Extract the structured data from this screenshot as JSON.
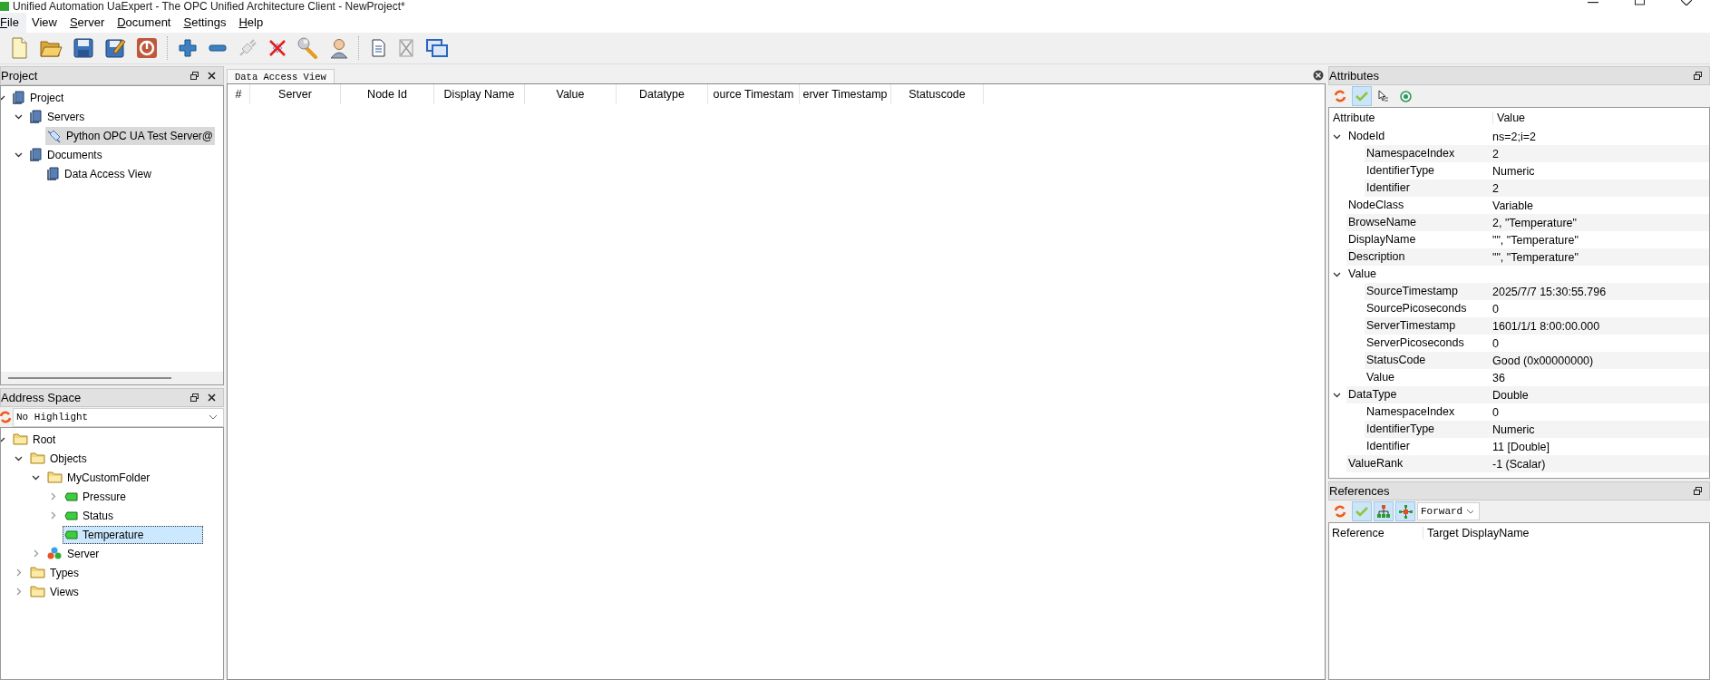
{
  "window": {
    "title": "Unified Automation UaExpert - The OPC Unified Architecture Client - NewProject*"
  },
  "menu": [
    {
      "label": "File",
      "underlined": true,
      "selected": true
    },
    {
      "label": "View",
      "underlined": false,
      "selected": false
    },
    {
      "label": "Server",
      "underlined": true,
      "selected": false
    },
    {
      "label": "Document",
      "underlined": true,
      "selected": false
    },
    {
      "label": "Settings",
      "underlined": true,
      "selected": false
    },
    {
      "label": "Help",
      "underlined": true,
      "selected": false
    }
  ],
  "project": {
    "title": "Project",
    "tree": [
      {
        "label": "Project",
        "kind": "book",
        "expanded": true,
        "selected": false,
        "children": [
          {
            "label": "Servers",
            "kind": "book",
            "expanded": true,
            "selected": false,
            "children": [
              {
                "label": "Python OPC UA Test Server@",
                "kind": "plug",
                "selected": true
              }
            ]
          },
          {
            "label": "Documents",
            "kind": "book",
            "expanded": true,
            "selected": false,
            "children": [
              {
                "label": "Data Access View",
                "kind": "book",
                "selected": false
              }
            ]
          }
        ]
      }
    ]
  },
  "address_space": {
    "title": "Address Space",
    "highlight": "No Highlight",
    "tree": [
      {
        "label": "Root",
        "kind": "folder",
        "expanded": true,
        "selected": false,
        "children": [
          {
            "label": "Objects",
            "kind": "folder",
            "expanded": true,
            "selected": false,
            "children": [
              {
                "label": "MyCustomFolder",
                "kind": "folder",
                "expanded": true,
                "selected": false,
                "children": [
                  {
                    "label": "Pressure",
                    "kind": "variable",
                    "expanded": false,
                    "selected": false
                  },
                  {
                    "label": "Status",
                    "kind": "variable",
                    "expanded": false,
                    "selected": false
                  },
                  {
                    "label": "Temperature",
                    "kind": "variable",
                    "selected": true
                  }
                ]
              },
              {
                "label": "Server",
                "kind": "object",
                "expanded": false,
                "selected": false
              }
            ]
          },
          {
            "label": "Types",
            "kind": "folder",
            "expanded": false,
            "selected": false
          },
          {
            "label": "Views",
            "kind": "folder",
            "expanded": false,
            "selected": false
          }
        ]
      }
    ]
  },
  "document_tab": {
    "label": "Data Access View"
  },
  "data_access_table": {
    "columns": [
      "#",
      "Server",
      "Node Id",
      "Display Name",
      "Value",
      "Datatype",
      "ource Timestam",
      "erver Timestamp",
      "Statuscode"
    ]
  },
  "attributes": {
    "title": "Attributes",
    "tools": [
      {
        "kind": "refresh",
        "on": false
      },
      {
        "kind": "check",
        "on": true
      },
      {
        "kind": "cursor",
        "on": false
      },
      {
        "kind": "target",
        "on": false
      }
    ],
    "columns": [
      "Attribute",
      "Value"
    ],
    "rows": [
      {
        "name": "NodeId",
        "value": "ns=2;i=2",
        "expanded": true,
        "children": [
          {
            "name": "NamespaceIndex",
            "value": "2"
          },
          {
            "name": "IdentifierType",
            "value": "Numeric"
          },
          {
            "name": "Identifier",
            "value": "2"
          }
        ]
      },
      {
        "name": "NodeClass",
        "value": "Variable"
      },
      {
        "name": "BrowseName",
        "value": "2, \"Temperature\""
      },
      {
        "name": "DisplayName",
        "value": "\"\", \"Temperature\""
      },
      {
        "name": "Description",
        "value": "\"\", \"Temperature\""
      },
      {
        "name": "Value",
        "expanded": true,
        "children": [
          {
            "name": "SourceTimestamp",
            "value": "2025/7/7 15:30:55.796"
          },
          {
            "name": "SourcePicoseconds",
            "value": "0"
          },
          {
            "name": "ServerTimestamp",
            "value": "1601/1/1 8:00:00.000"
          },
          {
            "name": "ServerPicoseconds",
            "value": "0"
          },
          {
            "name": "StatusCode",
            "value": "Good (0x00000000)"
          },
          {
            "name": "Value",
            "value": "36"
          }
        ]
      },
      {
        "name": "DataType",
        "value": "Double",
        "expanded": true,
        "children": [
          {
            "name": "NamespaceIndex",
            "value": "0"
          },
          {
            "name": "IdentifierType",
            "value": "Numeric"
          },
          {
            "name": "Identifier",
            "value": "11 [Double]"
          }
        ]
      },
      {
        "name": "ValueRank",
        "value": "-1 (Scalar)"
      }
    ]
  },
  "references": {
    "title": "References",
    "tools": [
      {
        "kind": "refresh",
        "on": false
      },
      {
        "kind": "check",
        "on": true
      },
      {
        "kind": "hierarchy",
        "on": true
      },
      {
        "kind": "network",
        "on": true
      }
    ],
    "direction": "Forward",
    "columns": [
      "Reference",
      "Target DisplayName"
    ]
  }
}
